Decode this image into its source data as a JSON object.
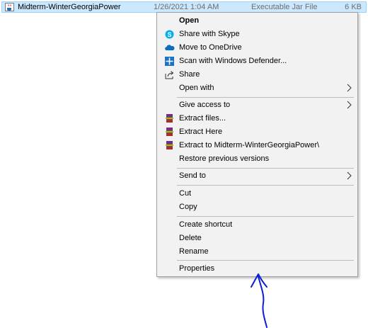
{
  "file": {
    "name": "Midterm-WinterGeorgiaPower",
    "date": "1/26/2021 1:04 AM",
    "type": "Executable Jar File",
    "size": "6 KB",
    "icon": "jar-file-icon"
  },
  "menu": {
    "items": [
      {
        "label": "Open"
      },
      {
        "label": "Share with Skype",
        "icon": "skype-icon"
      },
      {
        "label": "Move to OneDrive",
        "icon": "onedrive-icon"
      },
      {
        "label": "Scan with Windows Defender...",
        "icon": "defender-icon"
      },
      {
        "label": "Share",
        "icon": "share-icon"
      },
      {
        "label": "Open with"
      },
      {
        "label": "Give access to"
      },
      {
        "label": "Extract files...",
        "icon": "winrar-icon"
      },
      {
        "label": "Extract Here",
        "icon": "winrar-icon"
      },
      {
        "label": "Extract to Midterm-WinterGeorgiaPower\\",
        "icon": "winrar-icon"
      },
      {
        "label": "Restore previous versions"
      },
      {
        "label": "Send to"
      },
      {
        "label": "Cut"
      },
      {
        "label": "Copy"
      },
      {
        "label": "Create shortcut"
      },
      {
        "label": "Delete"
      },
      {
        "label": "Rename"
      },
      {
        "label": "Properties"
      }
    ]
  },
  "colors": {
    "selection": "#cce8ff",
    "menu_background": "#f2f2f2",
    "annotation": "#0a1fd6"
  }
}
